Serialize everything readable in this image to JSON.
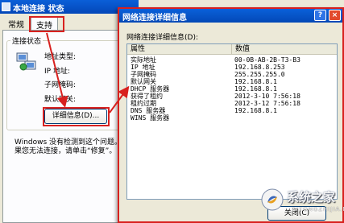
{
  "back_dialog": {
    "title": "本地连接 状态",
    "tabs": [
      {
        "label": "常规"
      },
      {
        "label": "支持"
      }
    ],
    "group_label": "连接状态",
    "field_labels": {
      "address_type": "地址类型:",
      "ip": "IP 地址:",
      "subnet_mask": "子网掩码:",
      "gateway": "默认网关:"
    },
    "details_button": "详细信息(D)...",
    "info_text": "Windows 没有检测到这个问题。如果您无法连接，请单击“修复”。"
  },
  "front_dialog": {
    "title": "网络连接详细信息",
    "help_icon": "?",
    "close_icon": "×",
    "caption": "网络连接详细信息(D):",
    "columns": {
      "property": "属性",
      "value": "数值"
    },
    "rows": [
      {
        "property": "实际地址",
        "value": "00-0B-AB-2B-T3-B3"
      },
      {
        "property": "IP 地址",
        "value": "192.168.8.253"
      },
      {
        "property": "子网掩码",
        "value": "255.255.255.0"
      },
      {
        "property": "默认网关",
        "value": "192.168.8.1"
      },
      {
        "property": "DHCP 服务器",
        "value": "192.168.8.1"
      },
      {
        "property": "获得了租约",
        "value": "2012-3-10 7:56:18"
      },
      {
        "property": "租约过期",
        "value": "2012-3-12 7:56:18"
      },
      {
        "property": "DNS 服务器",
        "value": "192.168.8.1"
      },
      {
        "property": "WINS 服务器",
        "value": ""
      }
    ],
    "close_button": "关闭(C)"
  },
  "watermark": {
    "name": "系统之家",
    "url": "XITONGZHIJIA.NET"
  },
  "colors": {
    "dialog_background": "#ece9d8",
    "titlebar_blue": "#0a5fd8",
    "highlight_red": "#d8211f"
  }
}
